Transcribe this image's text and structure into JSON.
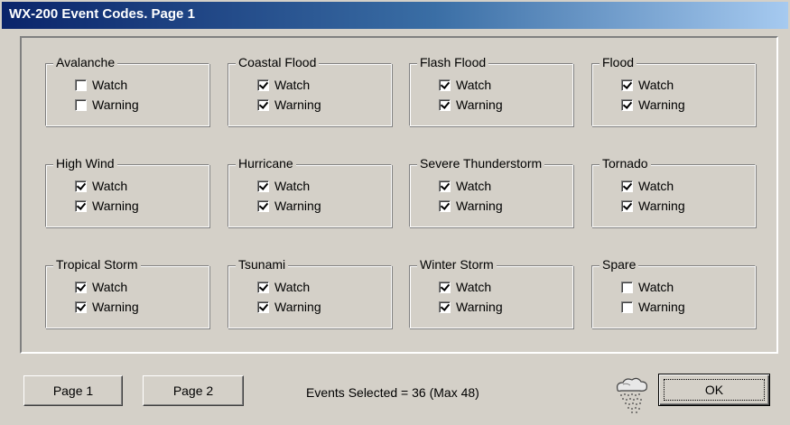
{
  "window": {
    "title": "WX-200 Event Codes. Page 1"
  },
  "groups": [
    {
      "name": "Avalanche",
      "watch": false,
      "warning": false
    },
    {
      "name": "Coastal Flood",
      "watch": true,
      "warning": true
    },
    {
      "name": "Flash Flood",
      "watch": true,
      "warning": true
    },
    {
      "name": "Flood",
      "watch": true,
      "warning": true
    },
    {
      "name": "High Wind",
      "watch": true,
      "warning": true
    },
    {
      "name": "Hurricane",
      "watch": true,
      "warning": true
    },
    {
      "name": "Severe Thunderstorm",
      "watch": true,
      "warning": true
    },
    {
      "name": "Tornado",
      "watch": true,
      "warning": true
    },
    {
      "name": "Tropical Storm",
      "watch": true,
      "warning": true
    },
    {
      "name": "Tsunami",
      "watch": true,
      "warning": true
    },
    {
      "name": "Winter Storm",
      "watch": true,
      "warning": true
    },
    {
      "name": "Spare",
      "watch": false,
      "warning": false
    }
  ],
  "labels": {
    "watch": "Watch",
    "warning": "Warning"
  },
  "buttons": {
    "page1": "Page 1",
    "page2": "Page 2",
    "ok": "OK"
  },
  "status": {
    "text": "Events Selected = 36   (Max 48)"
  },
  "icons": {
    "weather": "rain-cloud-icon"
  }
}
